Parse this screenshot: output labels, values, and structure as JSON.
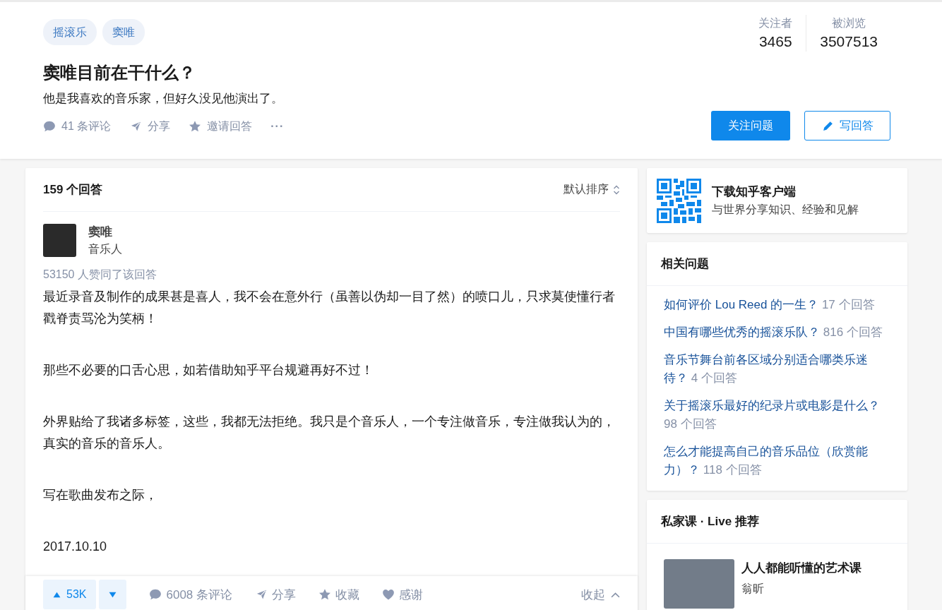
{
  "question": {
    "topics": [
      "摇滚乐",
      "窦唯"
    ],
    "title": "窦唯目前在干什么？",
    "detail": "他是我喜欢的音乐家，但好久没见他演出了。",
    "actions": [
      {
        "kind": "comment",
        "label": "41 条评论"
      },
      {
        "kind": "share",
        "label": "分享"
      },
      {
        "kind": "invite",
        "label": "邀请回答"
      },
      {
        "kind": "more",
        "label": "···"
      }
    ],
    "stats": [
      {
        "label": "关注者",
        "value": "3465"
      },
      {
        "label": "被浏览",
        "value": "3507513"
      }
    ],
    "follow_button": "关注问题",
    "write_button": "写回答"
  },
  "answers": {
    "count": "159 个回答",
    "sort": "默认排序",
    "answer": {
      "author": "窦唯",
      "headline": "音乐人",
      "votes_text": "53150 人赞同了该回答",
      "paragraphs": [
        "最近录音及制作的成果甚是喜人，我不会在意外行（虽善以伪却一目了然）的喷口儿，只求莫使懂行者戳脊责骂沦为笑柄！",
        "那些不必要的口舌心思，如若借助知乎平台规避再好不过！",
        "外界贴给了我诸多标签，这些，我都无法拒绝。我只是个音乐人，一个专注做音乐，专注做我认为的，真实的音乐的音乐人。",
        "写在歌曲发布之际，",
        "2017.10.10"
      ],
      "upvote": "53K",
      "actions": [
        {
          "kind": "comment",
          "label": "6008 条评论"
        },
        {
          "kind": "share",
          "label": "分享"
        },
        {
          "kind": "collect",
          "label": "收藏"
        },
        {
          "kind": "thanks",
          "label": "感谢"
        }
      ],
      "collapse": "收起"
    }
  },
  "sidebar": {
    "app": {
      "title": "下载知乎客户端",
      "subtitle": "与世界分享知识、经验和见解"
    },
    "related": {
      "title": "相关问题",
      "items": [
        {
          "question": "如何评价 Lou Reed 的一生？",
          "answers": "17 个回答"
        },
        {
          "question": "中国有哪些优秀的摇滚乐队？",
          "answers": "816 个回答"
        },
        {
          "question": "音乐节舞台前各区域分别适合哪类乐迷待？",
          "answers": "4 个回答"
        },
        {
          "question": "关于摇滚乐最好的纪录片或电影是什么？",
          "answers": "98 个回答"
        },
        {
          "question": "怎么才能提高自己的音乐品位（欣赏能力）？",
          "answers": "118 个回答"
        }
      ]
    },
    "live": {
      "title": "私家课 · Live 推荐",
      "course": "人人都能听懂的艺术课",
      "teacher": "翁昕"
    }
  }
}
